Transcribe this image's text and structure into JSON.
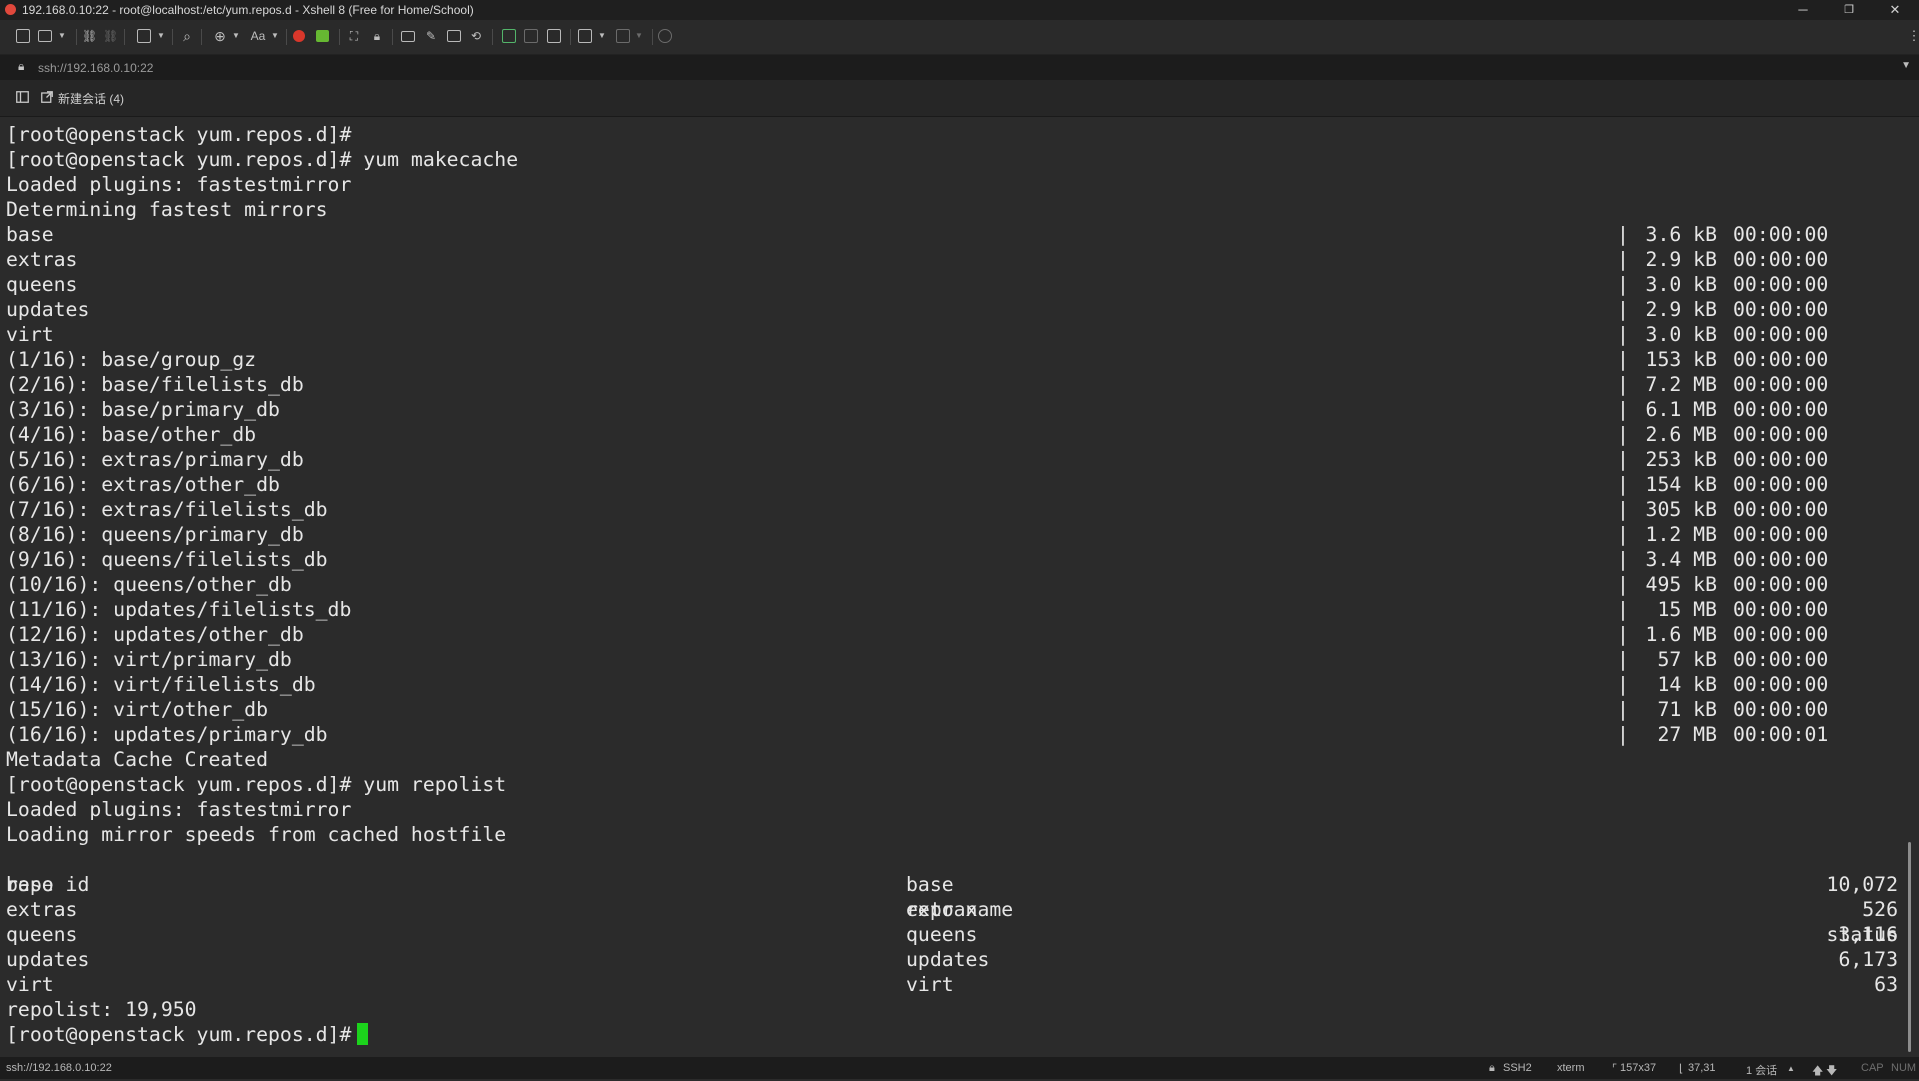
{
  "window": {
    "title": "192.168.0.10:22 - root@localhost:/etc/yum.repos.d - Xshell 8 (Free for Home/School)",
    "minimize": "─",
    "maximize": "❐",
    "close": "✕"
  },
  "toolbar": {
    "icons": [
      "new-session-icon",
      "open-folder-icon",
      "reconnect-icon",
      "disconnect-icon",
      "new-window-icon",
      "find-icon",
      "encoding-icon",
      "font-icon",
      "xftp-icon",
      "xmanager-icon",
      "fullscreen-icon",
      "lock-icon",
      "compose-icon",
      "highlight-icon",
      "script-icon",
      "transfer-icon",
      "sessions-icon",
      "tunneling-icon",
      "log-icon",
      "quick-command-icon",
      "layout-icon",
      "help-icon"
    ],
    "font_label": "Aa"
  },
  "address_bar": {
    "address": "ssh://192.168.0.10:22"
  },
  "tabs": {
    "new_tab_label": "新建会话 (4)"
  },
  "terminal": {
    "prompt": "[root@openstack yum.repos.d]#",
    "lines": [
      "[root@openstack yum.repos.d]#",
      "[root@openstack yum.repos.d]# yum makecache",
      "Loaded plugins: fastestmirror",
      "Determining fastest mirrors"
    ],
    "downloads": [
      {
        "name": "base",
        "size": "3.6 kB",
        "time": "00:00:00"
      },
      {
        "name": "extras",
        "size": "2.9 kB",
        "time": "00:00:00"
      },
      {
        "name": "queens",
        "size": "3.0 kB",
        "time": "00:00:00"
      },
      {
        "name": "updates",
        "size": "2.9 kB",
        "time": "00:00:00"
      },
      {
        "name": "virt",
        "size": "3.0 kB",
        "time": "00:00:00"
      },
      {
        "name": "(1/16): base/group_gz",
        "size": "153 kB",
        "time": "00:00:00"
      },
      {
        "name": "(2/16): base/filelists_db",
        "size": "7.2 MB",
        "time": "00:00:00"
      },
      {
        "name": "(3/16): base/primary_db",
        "size": "6.1 MB",
        "time": "00:00:00"
      },
      {
        "name": "(4/16): base/other_db",
        "size": "2.6 MB",
        "time": "00:00:00"
      },
      {
        "name": "(5/16): extras/primary_db",
        "size": "253 kB",
        "time": "00:00:00"
      },
      {
        "name": "(6/16): extras/other_db",
        "size": "154 kB",
        "time": "00:00:00"
      },
      {
        "name": "(7/16): extras/filelists_db",
        "size": "305 kB",
        "time": "00:00:00"
      },
      {
        "name": "(8/16): queens/primary_db",
        "size": "1.2 MB",
        "time": "00:00:00"
      },
      {
        "name": "(9/16): queens/filelists_db",
        "size": "3.4 MB",
        "time": "00:00:00"
      },
      {
        "name": "(10/16): queens/other_db",
        "size": "495 kB",
        "time": "00:00:00"
      },
      {
        "name": "(11/16): updates/filelists_db",
        "size": " 15 MB",
        "time": "00:00:00"
      },
      {
        "name": "(12/16): updates/other_db",
        "size": "1.6 MB",
        "time": "00:00:00"
      },
      {
        "name": "(13/16): virt/primary_db",
        "size": " 57 kB",
        "time": "00:00:00"
      },
      {
        "name": "(14/16): virt/filelists_db",
        "size": " 14 kB",
        "time": "00:00:00"
      },
      {
        "name": "(15/16): virt/other_db",
        "size": " 71 kB",
        "time": "00:00:00"
      },
      {
        "name": "(16/16): updates/primary_db",
        "size": " 27 MB",
        "time": "00:00:01"
      }
    ],
    "after_lines": [
      "Metadata Cache Created",
      "[root@openstack yum.repos.d]# yum repolist",
      "Loaded plugins: fastestmirror",
      "Loading mirror speeds from cached hostfile"
    ],
    "repolist_header": {
      "id": "repo id",
      "name": "repo name",
      "status": "status"
    },
    "repolist": [
      {
        "id": "base",
        "name": "base",
        "status": "10,072"
      },
      {
        "id": "extras",
        "name": "extrax",
        "status": "526"
      },
      {
        "id": "queens",
        "name": "queens",
        "status": "3,116"
      },
      {
        "id": "updates",
        "name": "updates",
        "status": "6,173"
      },
      {
        "id": "virt",
        "name": "virt",
        "status": "63"
      }
    ],
    "repolist_total": "repolist: 19,950",
    "cursor_color": "#1cd31c"
  },
  "status_bar": {
    "address": "ssh://192.168.0.10:22",
    "protocol": "SSH2",
    "term_type": "xterm",
    "size": "157x37",
    "cursor_pos": "37,31",
    "sessions": "1 会话",
    "cap": "CAP",
    "num": "NUM"
  }
}
